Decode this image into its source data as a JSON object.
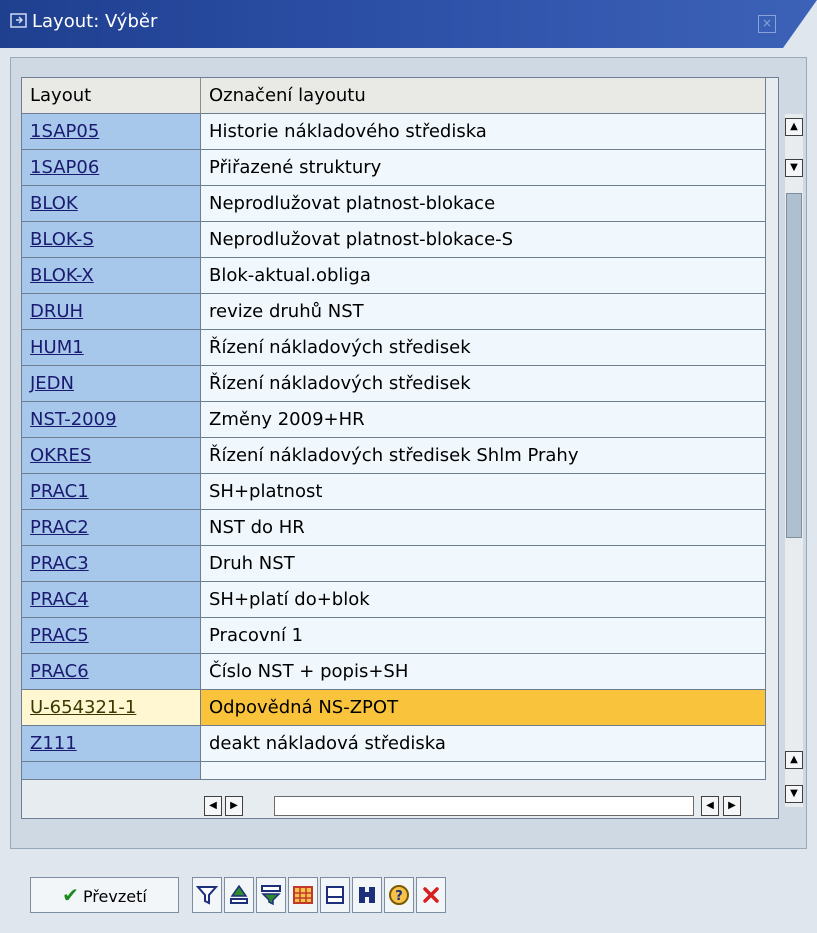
{
  "window": {
    "title": "Layout: Výběr",
    "title_icon": "window-icon",
    "close_icon": "close-icon"
  },
  "table": {
    "columns": [
      "Layout",
      "Označení layoutu"
    ],
    "rows": [
      {
        "layout": "1SAP05",
        "desc": "Historie nákladového střediska"
      },
      {
        "layout": "1SAP06",
        "desc": "Přiřazené struktury"
      },
      {
        "layout": "BLOK",
        "desc": "Neprodlužovat platnost-blokace"
      },
      {
        "layout": "BLOK-S",
        "desc": "Neprodlužovat platnost-blokace-S"
      },
      {
        "layout": "BLOK-X",
        "desc": "Blok-aktual.obliga"
      },
      {
        "layout": "DRUH",
        "desc": "revize druhů NST"
      },
      {
        "layout": "HUM1",
        "desc": "Řízení nákladových středisek"
      },
      {
        "layout": "JEDN",
        "desc": "Řízení nákladových středisek"
      },
      {
        "layout": "NST-2009",
        "desc": "Změny 2009+HR"
      },
      {
        "layout": "OKRES",
        "desc": "Řízení nákladových středisek Shlm Prahy"
      },
      {
        "layout": "PRAC1",
        "desc": "SH+platnost"
      },
      {
        "layout": "PRAC2",
        "desc": "NST do HR"
      },
      {
        "layout": "PRAC3",
        "desc": "Druh NST"
      },
      {
        "layout": "PRAC4",
        "desc": "SH+platí do+blok"
      },
      {
        "layout": "PRAC5",
        "desc": "Pracovní 1"
      },
      {
        "layout": "PRAC6",
        "desc": "Číslo NST + popis+SH"
      },
      {
        "layout": "U-654321-1",
        "desc": "Odpovědná NS-ZPOT",
        "selected": true
      },
      {
        "layout": "Z111",
        "desc": "deakt nákladová střediska"
      }
    ]
  },
  "toolbar": {
    "accept_label": "Převzetí",
    "accept_icon": "checkmark-icon",
    "icons": [
      "filter-icon",
      "sort-icon",
      "sum-icon",
      "grid-icon",
      "print-icon",
      "find-icon",
      "help-icon",
      "cancel-icon"
    ]
  },
  "colors": {
    "selected_row": "#f9c33b",
    "key_column": "#a7c8ea",
    "title_bar": "#2c4fa6"
  }
}
